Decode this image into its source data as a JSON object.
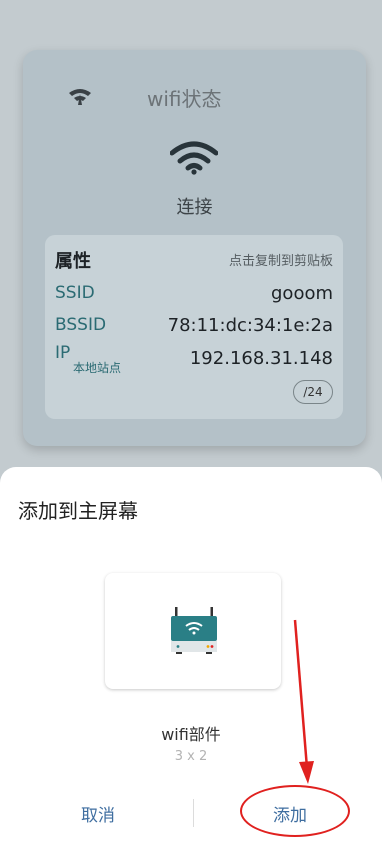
{
  "card": {
    "title": "wifi状态",
    "status": "连接",
    "props_label": "属性",
    "props_hint": "点击复制到剪贴板",
    "rows": [
      {
        "key": "SSID",
        "value": "gooom"
      },
      {
        "key": "BSSID",
        "value": "78:11:dc:34:1e:2a"
      },
      {
        "key": "IP",
        "sub": "本地站点",
        "value": "192.168.31.148"
      }
    ],
    "counter": "/24"
  },
  "sheet": {
    "title": "添加到主屏幕",
    "widget_name": "wifi部件",
    "widget_size": "3 x 2",
    "cancel_label": "取消",
    "add_label": "添加"
  },
  "colors": {
    "accent": "#3f6ea0",
    "annotation": "#e0211f",
    "card_bg": "#b4c1c8",
    "wifi_icon": "#28343a"
  },
  "icons": [
    "wifi-small-icon",
    "wifi-large-icon",
    "router-widget-icon"
  ]
}
